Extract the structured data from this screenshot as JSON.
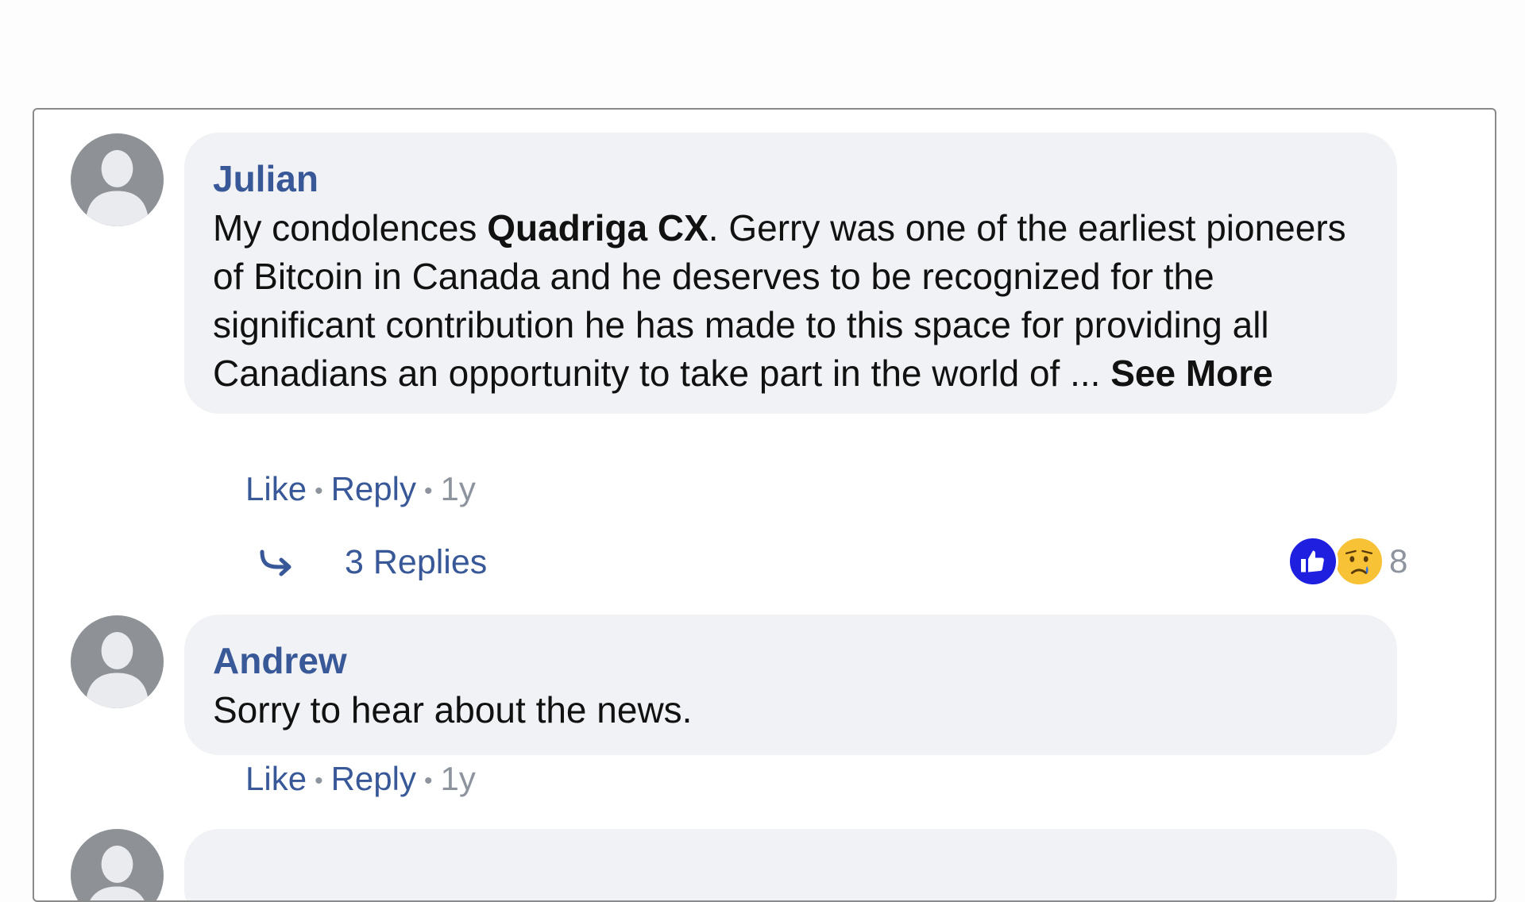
{
  "comments": [
    {
      "author": "Julian",
      "text_before": "My condolences ",
      "mention": "Quadriga CX",
      "text_after": ". Gerry was one of the earliest pioneers of Bitcoin in Canada and he deserves to be recognized for the significant contribution he has made to this space for providing all Canadians an opportunity to take part in the world of ... ",
      "see_more": "See More",
      "like_label": "Like",
      "reply_label": "Reply",
      "age": "1y",
      "reactions": {
        "icons": [
          "like-icon",
          "sad-icon"
        ],
        "count": "8"
      },
      "replies_label": "3 Replies"
    },
    {
      "author": "Andrew",
      "text": "Sorry to hear about the news.",
      "like_label": "Like",
      "reply_label": "Reply",
      "age": "1y"
    }
  ],
  "colors": {
    "link": "#385898",
    "bubble": "#f1f2f5",
    "like_reaction": "#1f1fe0",
    "sad_reaction": "#f7c235",
    "meta": "#8d949e"
  }
}
